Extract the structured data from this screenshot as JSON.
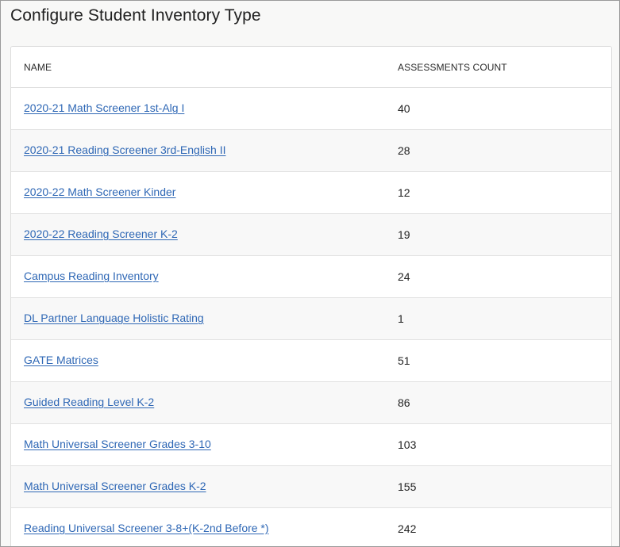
{
  "page": {
    "title": "Configure Student Inventory Type"
  },
  "table": {
    "columns": {
      "name": "NAME",
      "count": "ASSESSMENTS COUNT"
    },
    "rows": [
      {
        "name": "2020-21 Math Screener 1st-Alg I",
        "count": "40"
      },
      {
        "name": "2020-21 Reading Screener 3rd-English II",
        "count": "28"
      },
      {
        "name": "2020-22 Math Screener Kinder",
        "count": "12"
      },
      {
        "name": "2020-22 Reading Screener K-2",
        "count": "19"
      },
      {
        "name": "Campus Reading Inventory",
        "count": "24"
      },
      {
        "name": "DL Partner Language Holistic Rating",
        "count": "1"
      },
      {
        "name": "GATE Matrices",
        "count": "51"
      },
      {
        "name": "Guided Reading Level K-2",
        "count": "86"
      },
      {
        "name": "Math Universal Screener Grades 3-10",
        "count": "103"
      },
      {
        "name": "Math Universal Screener Grades K-2",
        "count": "155"
      },
      {
        "name": "Reading Universal Screener 3-8+(K-2nd Before *)",
        "count": "242"
      }
    ]
  },
  "colors": {
    "link": "#2e67b5",
    "text": "#1f1f1f",
    "border": "#dcdcdc",
    "background": "#f8f8f7"
  }
}
